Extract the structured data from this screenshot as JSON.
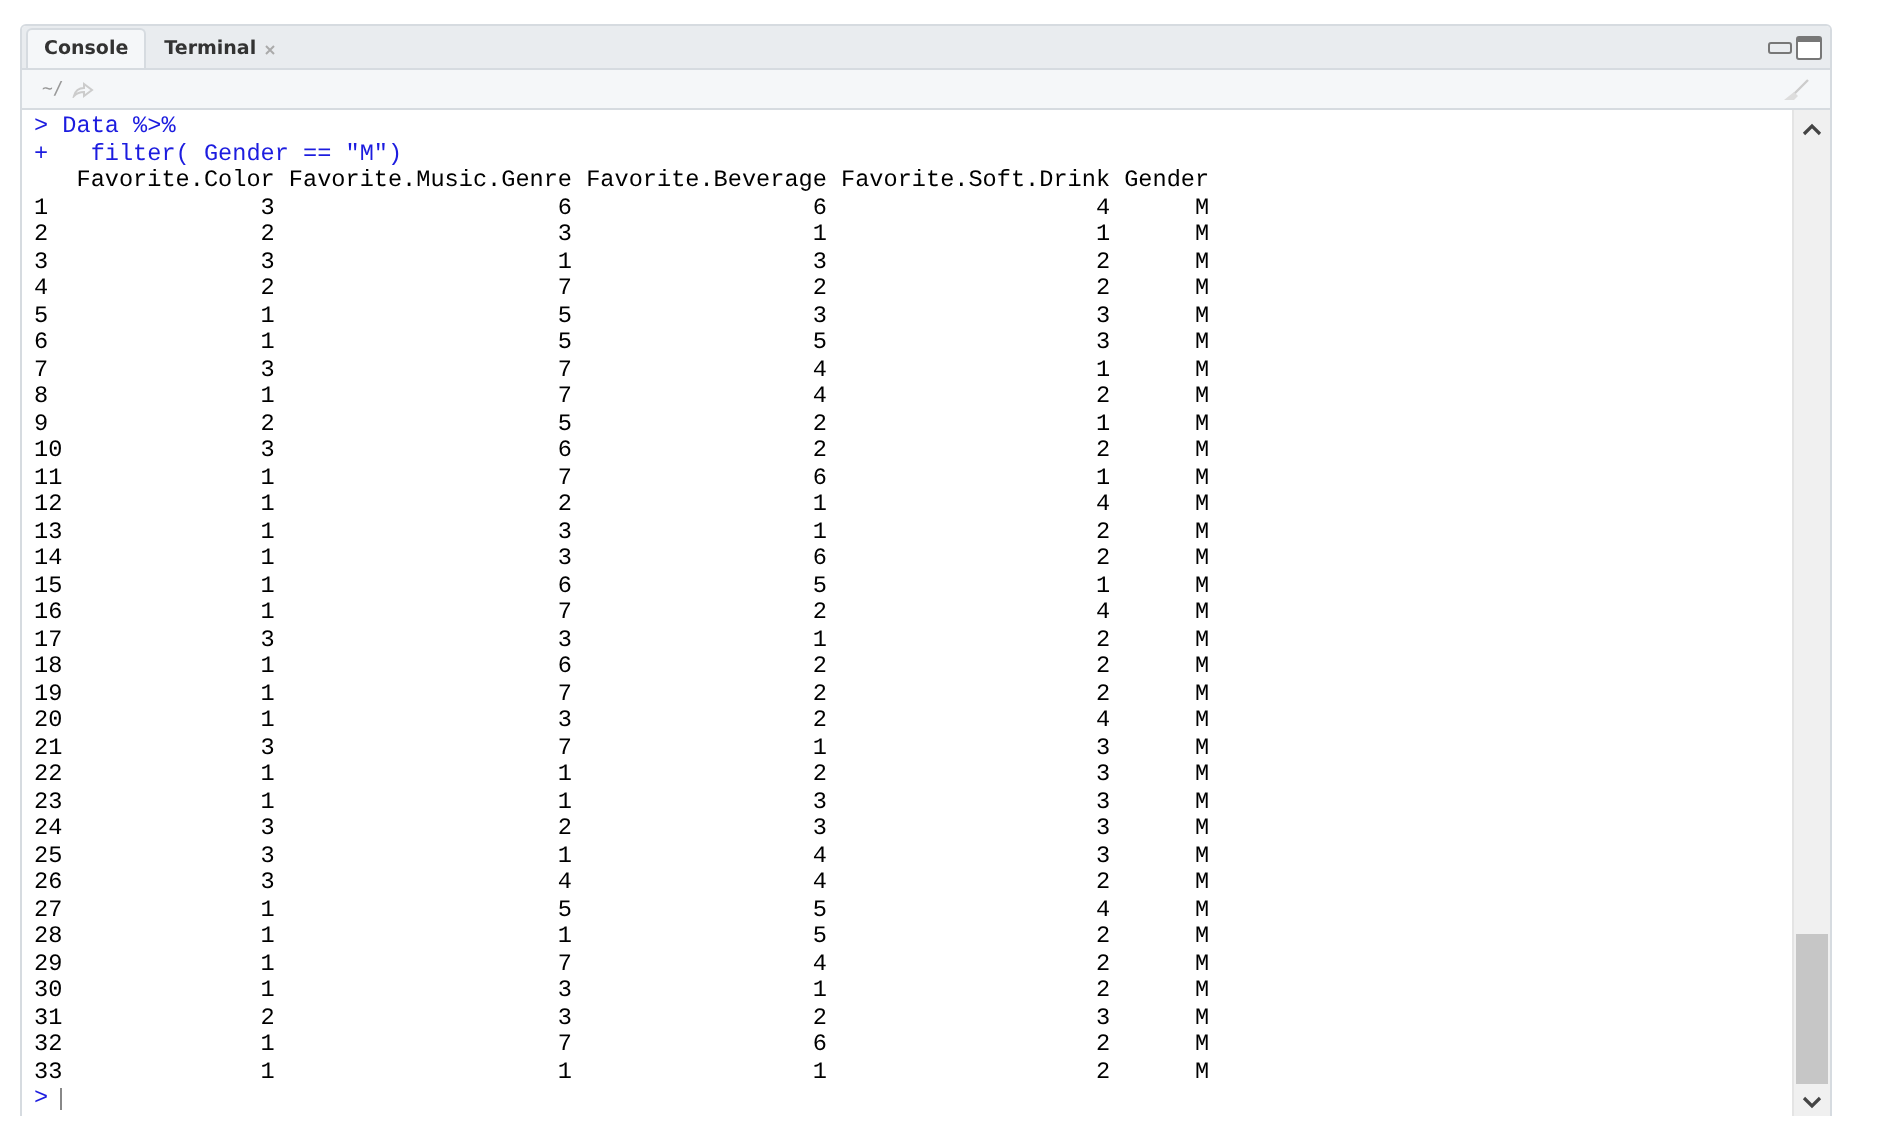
{
  "tabs": [
    {
      "label": "Console",
      "selected": true,
      "closable": false
    },
    {
      "label": "Terminal",
      "selected": false,
      "closable": true
    }
  ],
  "path": "~/",
  "commands": [
    {
      "prompt": ">",
      "text": "Data %>%"
    },
    {
      "prompt": "+",
      "text": "  filter( Gender == \"M\")"
    }
  ],
  "table": {
    "columns": [
      "",
      "Favorite.Color",
      "Favorite.Music.Genre",
      "Favorite.Beverage",
      "Favorite.Soft.Drink",
      "Gender"
    ],
    "rows": [
      [
        "1",
        "3",
        "6",
        "6",
        "4",
        "M"
      ],
      [
        "2",
        "2",
        "3",
        "1",
        "1",
        "M"
      ],
      [
        "3",
        "3",
        "1",
        "3",
        "2",
        "M"
      ],
      [
        "4",
        "2",
        "7",
        "2",
        "2",
        "M"
      ],
      [
        "5",
        "1",
        "5",
        "3",
        "3",
        "M"
      ],
      [
        "6",
        "1",
        "5",
        "5",
        "3",
        "M"
      ],
      [
        "7",
        "3",
        "7",
        "4",
        "1",
        "M"
      ],
      [
        "8",
        "1",
        "7",
        "4",
        "2",
        "M"
      ],
      [
        "9",
        "2",
        "5",
        "2",
        "1",
        "M"
      ],
      [
        "10",
        "3",
        "6",
        "2",
        "2",
        "M"
      ],
      [
        "11",
        "1",
        "7",
        "6",
        "1",
        "M"
      ],
      [
        "12",
        "1",
        "2",
        "1",
        "4",
        "M"
      ],
      [
        "13",
        "1",
        "3",
        "1",
        "2",
        "M"
      ],
      [
        "14",
        "1",
        "3",
        "6",
        "2",
        "M"
      ],
      [
        "15",
        "1",
        "6",
        "5",
        "1",
        "M"
      ],
      [
        "16",
        "1",
        "7",
        "2",
        "4",
        "M"
      ],
      [
        "17",
        "3",
        "3",
        "1",
        "2",
        "M"
      ],
      [
        "18",
        "1",
        "6",
        "2",
        "2",
        "M"
      ],
      [
        "19",
        "1",
        "7",
        "2",
        "2",
        "M"
      ],
      [
        "20",
        "1",
        "3",
        "2",
        "4",
        "M"
      ],
      [
        "21",
        "3",
        "7",
        "1",
        "3",
        "M"
      ],
      [
        "22",
        "1",
        "1",
        "2",
        "3",
        "M"
      ],
      [
        "23",
        "1",
        "1",
        "3",
        "3",
        "M"
      ],
      [
        "24",
        "3",
        "2",
        "3",
        "3",
        "M"
      ],
      [
        "25",
        "3",
        "1",
        "4",
        "3",
        "M"
      ],
      [
        "26",
        "3",
        "4",
        "4",
        "2",
        "M"
      ],
      [
        "27",
        "1",
        "5",
        "5",
        "4",
        "M"
      ],
      [
        "28",
        "1",
        "1",
        "5",
        "2",
        "M"
      ],
      [
        "29",
        "1",
        "7",
        "4",
        "2",
        "M"
      ],
      [
        "30",
        "1",
        "3",
        "1",
        "2",
        "M"
      ],
      [
        "31",
        "2",
        "3",
        "2",
        "3",
        "M"
      ],
      [
        "32",
        "1",
        "7",
        "6",
        "2",
        "M"
      ],
      [
        "33",
        "1",
        "1",
        "1",
        "2",
        "M"
      ]
    ]
  },
  "input_prompt": ">"
}
